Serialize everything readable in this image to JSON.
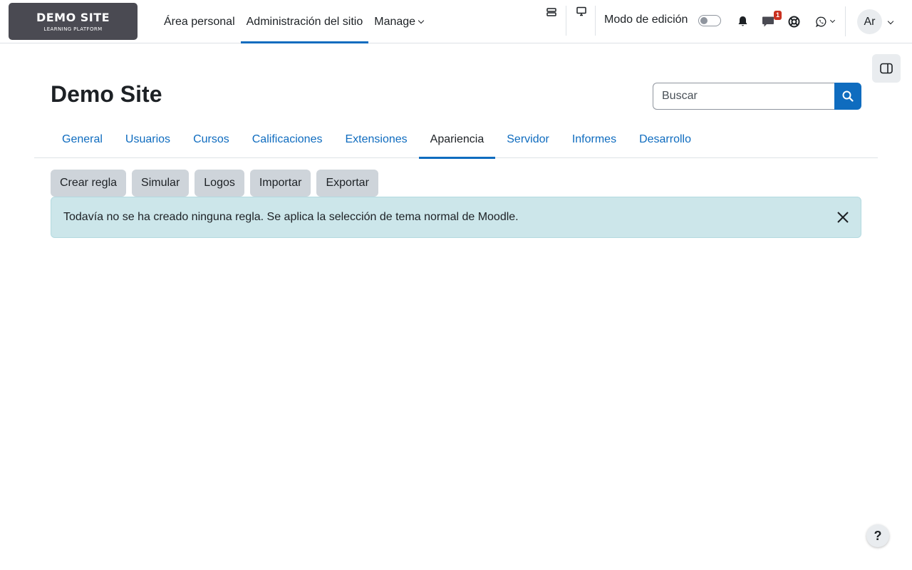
{
  "logo": {
    "title": "DEMO SITE",
    "subtitle": "LEARNING PLATFORM"
  },
  "primary_nav": {
    "items": [
      {
        "label": "Área personal",
        "active": false
      },
      {
        "label": "Administración del sitio",
        "active": true
      },
      {
        "label": "Manage",
        "active": false,
        "has_dropdown": true
      }
    ]
  },
  "header_tools": {
    "edit_mode_label": "Modo de edición",
    "edit_mode_on": false,
    "messages_badge": "1",
    "avatar_initials": "Ar",
    "icons": [
      "list-icon",
      "monitor-icon",
      "bell-icon",
      "message-icon",
      "lifebuoy-icon",
      "whatsapp-icon"
    ]
  },
  "page": {
    "title": "Demo Site"
  },
  "search": {
    "placeholder": "Buscar"
  },
  "secondary_nav": {
    "tabs": [
      {
        "label": "General"
      },
      {
        "label": "Usuarios"
      },
      {
        "label": "Cursos"
      },
      {
        "label": "Calificaciones"
      },
      {
        "label": "Extensiones"
      },
      {
        "label": "Apariencia",
        "active": true
      },
      {
        "label": "Servidor"
      },
      {
        "label": "Informes"
      },
      {
        "label": "Desarrollo"
      }
    ]
  },
  "actions": {
    "buttons": [
      {
        "label": "Crear regla"
      },
      {
        "label": "Simular"
      },
      {
        "label": "Logos"
      },
      {
        "label": "Importar"
      },
      {
        "label": "Exportar"
      }
    ]
  },
  "alert": {
    "message": "Todavía no se ha creado ninguna regla. Se aplica la selección de tema normal de Moodle."
  },
  "help": {
    "label": "?"
  },
  "colors": {
    "brand": "#0f6cbf",
    "alert_bg": "#cce6ea",
    "button_bg": "#ced4da",
    "logo_bg": "#4a4a52",
    "badge": "#ca3120"
  }
}
